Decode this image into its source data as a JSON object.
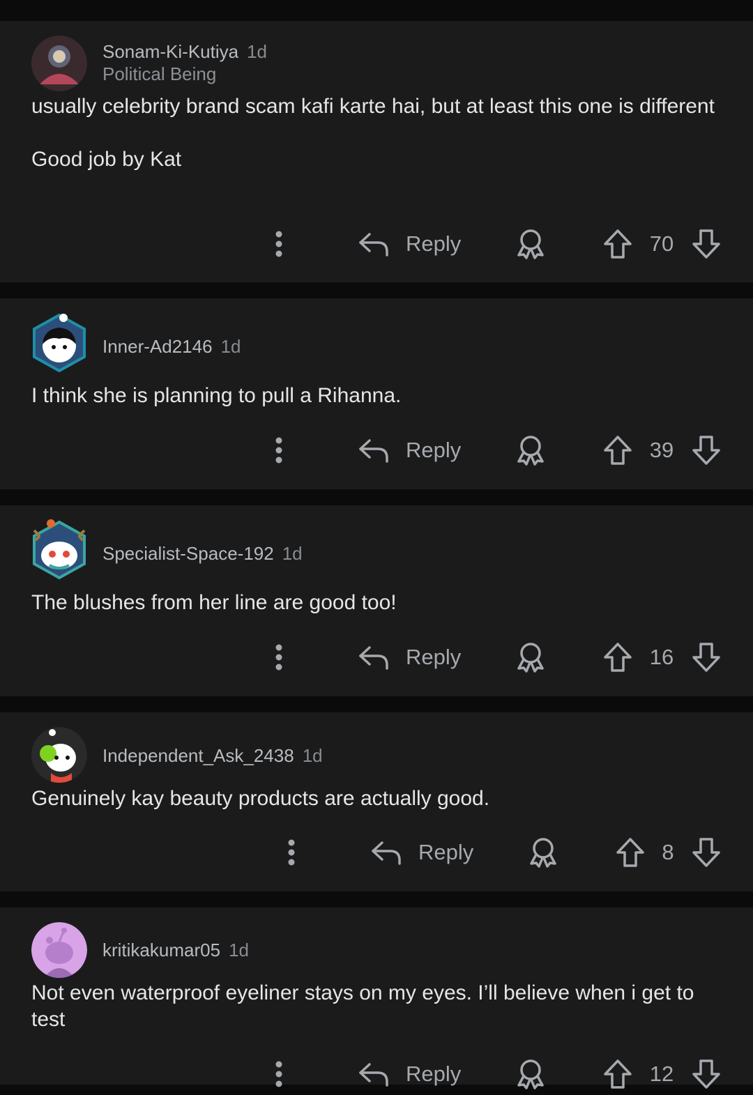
{
  "comments": [
    {
      "username": "Sonam-Ki-Kutiya",
      "age": "1d",
      "flair": "Political Being",
      "body": "usually celebrity brand scam kafi karte hai, but at least this one is different\n\nGood job by Kat",
      "reply_label": "Reply",
      "score": "70",
      "avatar_colors": [
        "#3a2a2e",
        "#b5475b",
        "#7a8ca8"
      ]
    },
    {
      "username": "Inner-Ad2146",
      "age": "1d",
      "flair": "",
      "body": "I think she is planning to pull a Rihanna.",
      "reply_label": "Reply",
      "score": "39",
      "avatar_colors": [
        "#1f8fa8",
        "#2b4f7a",
        "#ffffff"
      ]
    },
    {
      "username": "Specialist-Space-192",
      "age": "1d",
      "flair": "",
      "body": "The blushes from her line are good too!",
      "reply_label": "Reply",
      "score": "16",
      "avatar_colors": [
        "#3aa6a0",
        "#2b4f7a",
        "#ffffff"
      ]
    },
    {
      "username": "Independent_Ask_2438",
      "age": "1d",
      "flair": "",
      "body": "Genuinely kay beauty products are actually good.",
      "reply_label": "Reply",
      "score": "8",
      "avatar_colors": [
        "#2a2a2a",
        "#7ed321",
        "#ffffff"
      ]
    },
    {
      "username": "kritikakumar05",
      "age": "1d",
      "flair": "",
      "body": "Not even waterproof eyeliner stays on my eyes. I’ll believe when i get to test",
      "reply_label": "Reply",
      "score": "12",
      "avatar_colors": [
        "#d9a3e8",
        "#b57fcb",
        "#9b6bb3"
      ]
    }
  ]
}
